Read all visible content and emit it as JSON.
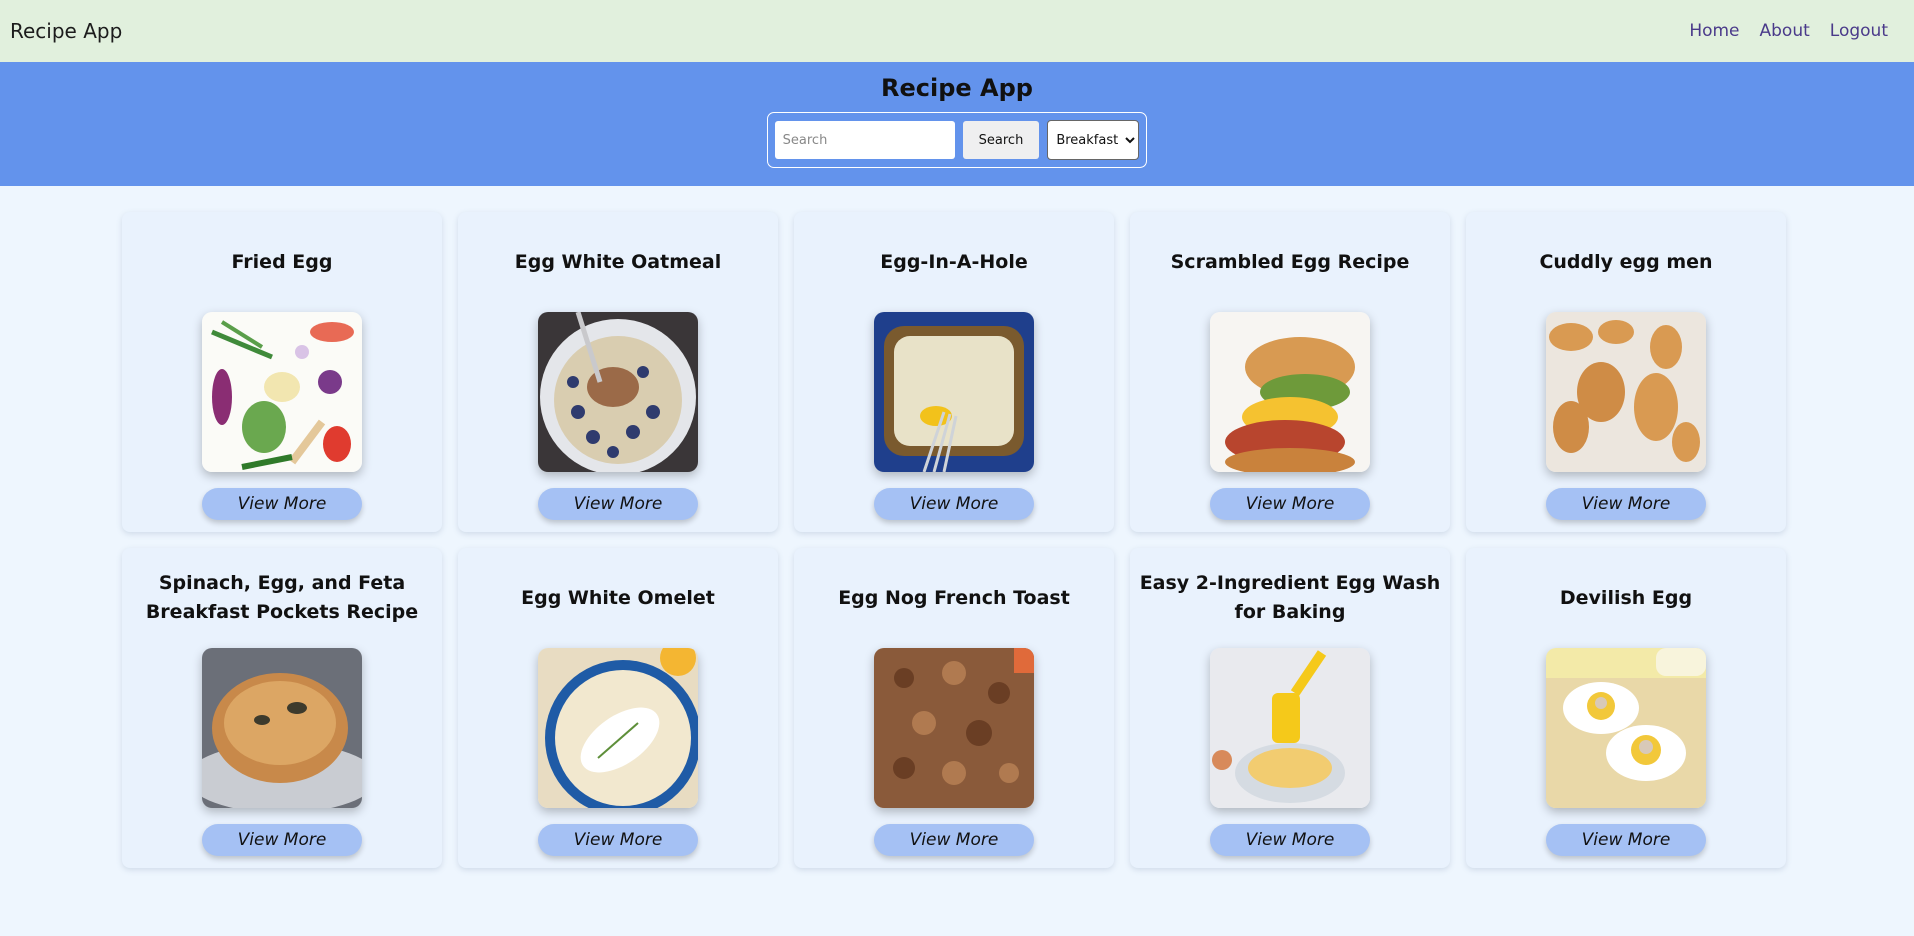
{
  "nav": {
    "brand": "Recipe App",
    "links": [
      "Home",
      "About",
      "Logout"
    ]
  },
  "hero": {
    "title": "Recipe App",
    "search_placeholder": "Search",
    "search_button": "Search",
    "category_selected": "Breakfast"
  },
  "recipes": [
    {
      "title": "Fried Egg",
      "button": "View More"
    },
    {
      "title": "Egg White Oatmeal",
      "button": "View More"
    },
    {
      "title": "Egg-In-A-Hole",
      "button": "View More"
    },
    {
      "title": "Scrambled Egg Recipe",
      "button": "View More"
    },
    {
      "title": "Cuddly egg men",
      "button": "View More"
    },
    {
      "title": "Spinach, Egg, and Feta Breakfast Pockets Recipe",
      "button": "View More"
    },
    {
      "title": "Egg White Omelet",
      "button": "View More"
    },
    {
      "title": "Egg Nog French Toast",
      "button": "View More"
    },
    {
      "title": "Easy 2-Ingredient Egg Wash for Baking",
      "button": "View More"
    },
    {
      "title": "Devilish Egg",
      "button": "View More"
    }
  ],
  "colors": {
    "nav_bg": "#e1f0dd",
    "hero_bg": "#6393ec",
    "page_bg": "#eef6fe",
    "card_bg": "#e9f2fd",
    "button_bg": "#a5c1f4"
  }
}
